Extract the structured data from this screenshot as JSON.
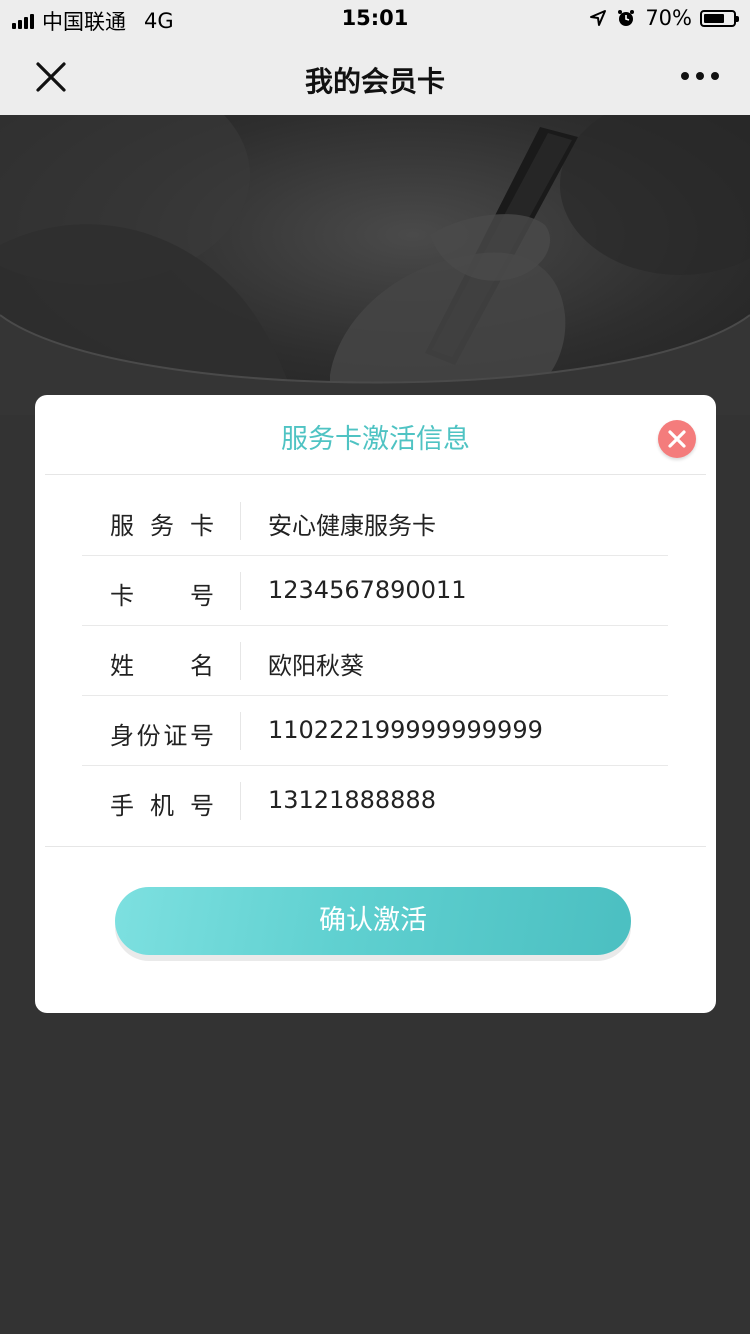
{
  "status_bar": {
    "carrier": "中国联通",
    "network": "4G",
    "time": "15:01",
    "battery": "70%",
    "battery_level": 0.7,
    "icons": [
      "signal-icon",
      "location-arrow-icon",
      "alarm-icon",
      "battery-icon"
    ]
  },
  "nav": {
    "title": "我的会员卡",
    "close_icon": "close-icon",
    "more_icon": "more-icon"
  },
  "modal": {
    "title": "服务卡激活信息",
    "close_icon": "close-circle-icon",
    "fields": [
      {
        "label": "服务卡",
        "value": "安心健康服务卡"
      },
      {
        "label": "卡号",
        "value": "1234567890011"
      },
      {
        "label": "姓名",
        "value": "欧阳秋葵"
      },
      {
        "label": "身份证号",
        "value": "110222199999999999"
      },
      {
        "label": "手机号",
        "value": "13121888888"
      }
    ],
    "confirm_label": "确认激活"
  },
  "colors": {
    "accent": "#4fc3c3",
    "close_button": "#f47c7c",
    "background": "#333333"
  }
}
